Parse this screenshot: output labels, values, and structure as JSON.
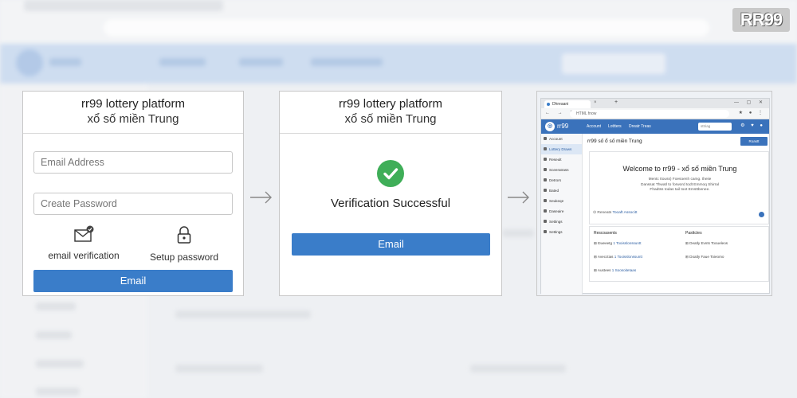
{
  "badge": {
    "text": "RR99"
  },
  "step1": {
    "title": "rr99 lottery platform",
    "subtitle": "xổ số miền Trung",
    "email_placeholder": "Email Address",
    "password_placeholder": "Create Password",
    "email_verification_label": "email verification",
    "setup_password_label": "Setup password",
    "submit_label": "Email"
  },
  "step2": {
    "title": "rr99 lottery platform",
    "subtitle": "xổ số miền Trung",
    "status_text": "Verification Successful",
    "button_label": "Email"
  },
  "step3": {
    "tab_title": "Dhreaani",
    "url": "HTML fnow",
    "brand": "rr99",
    "nav_links": [
      "Account",
      "Lottters",
      "Dreatr Treas"
    ],
    "search_placeholder": "sttriag",
    "page_title": "rr99 số ổ số miền Trung",
    "page_button": "Roastt",
    "sidebar_items": [
      "Account",
      "Lottery Draws",
      "Reseult",
      "Sceeratrass",
      "Detrors",
      "Bated",
      "Seukeqe",
      "Daseaire",
      "Settings",
      "Settings"
    ],
    "welcome_text": "Welcome to rr99 - xổ số miền Trung",
    "description_lines": [
      "Mentc Itouss) Foesoenh camg. theiie",
      "Danssat Thwatl to forword todt Emmoq Shirral",
      "Fhadtss todas tail toot Emsttbenee."
    ],
    "card_footer_label": "Reneats",
    "card_footer_link": "Tooaft Associtt",
    "list_left_header": "Rescoasents",
    "list_right_header": "Pasttctes",
    "list_left_items": [
      {
        "label": "Eweeetg",
        "link": "1 Tooisslonssuntt"
      },
      {
        "label": "Avecctias",
        "link": "1 Tooisslonssuntt"
      },
      {
        "label": "Austees",
        "link": "1 Soosoitetaas"
      }
    ],
    "list_right_items": [
      {
        "label": "Deatly Evnts Tooueleos"
      },
      {
        "label": "Doatly Faue Toieomo"
      }
    ]
  },
  "colors": {
    "primary": "#3a7dc9",
    "success": "#3fae58",
    "nav": "#3a72bb"
  }
}
